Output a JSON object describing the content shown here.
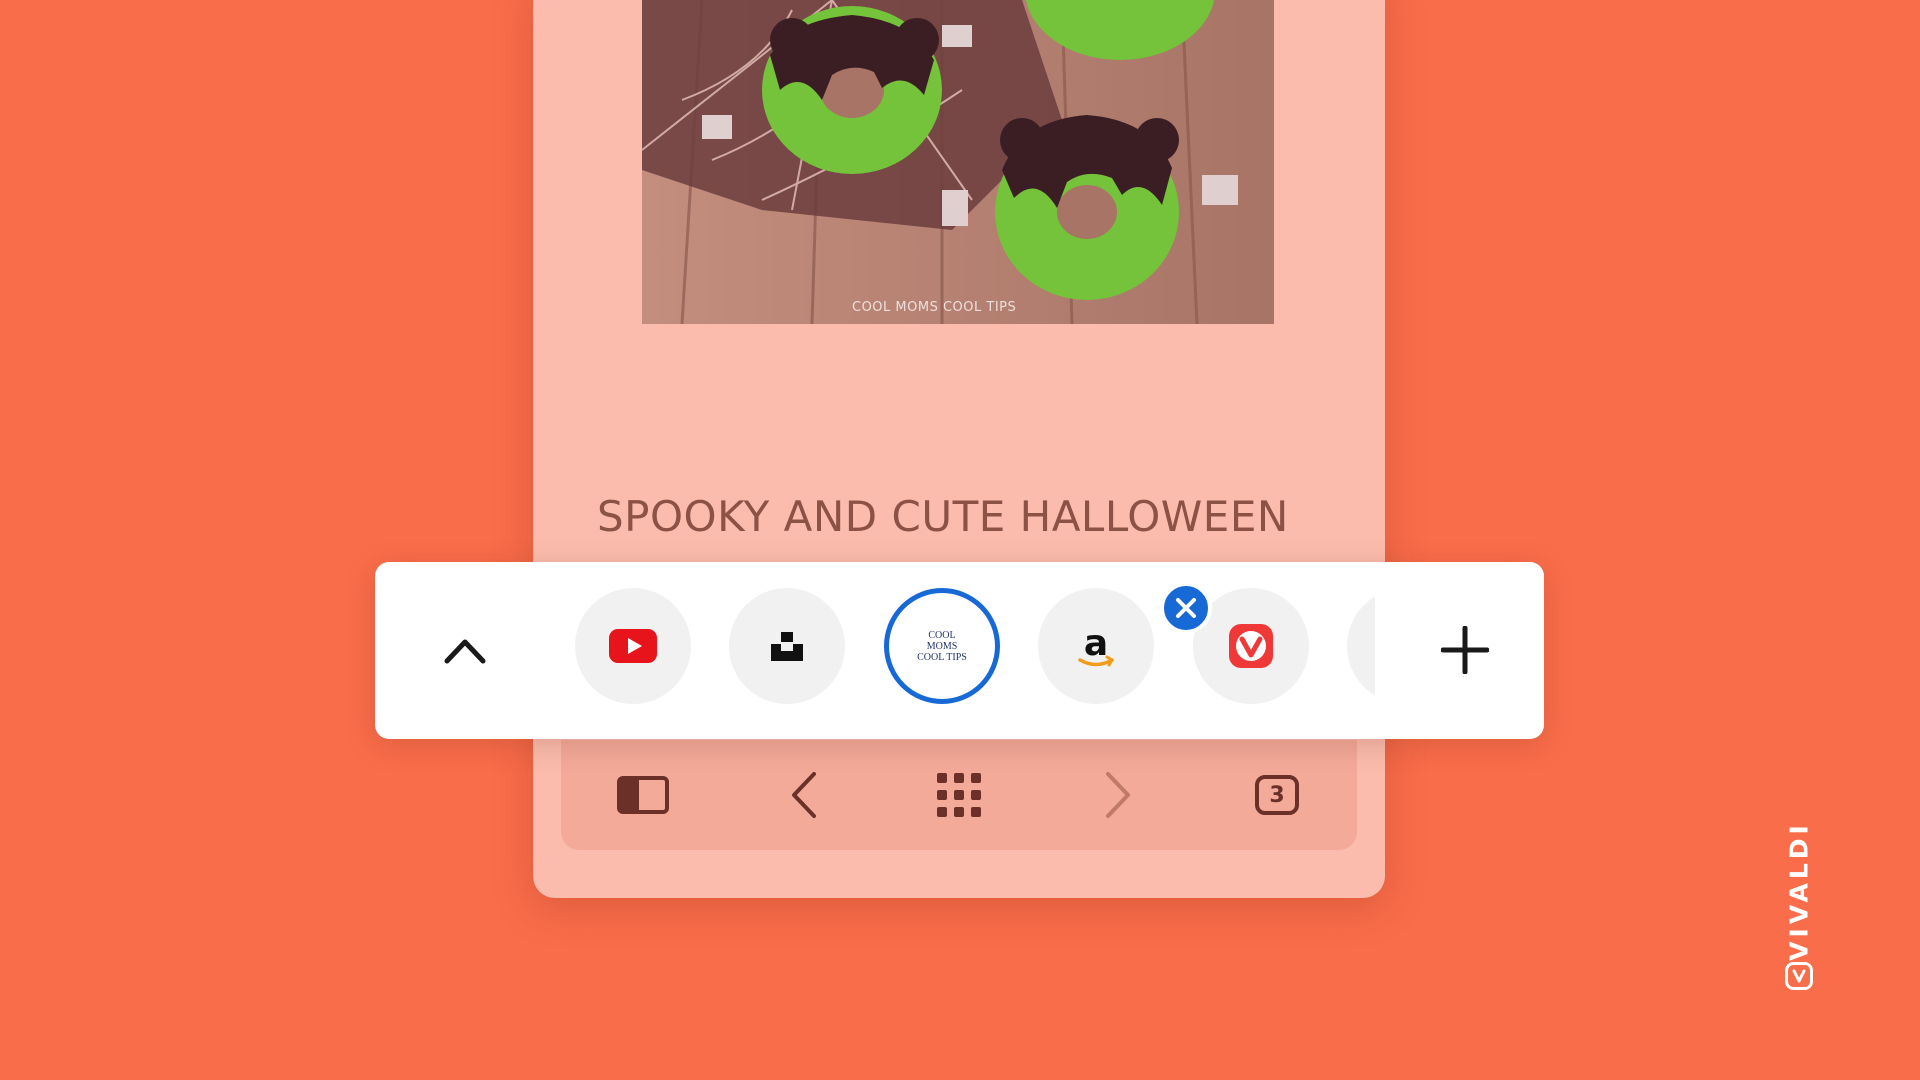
{
  "article": {
    "title": "SPOOKY AND CUTE HALLOWEEN",
    "photo_alt": "green frosted donuts on spider web napkin",
    "photo_watermark": "COOL MOMS COOL TIPS"
  },
  "tab_bar": {
    "collapse_icon": "chevron-up-icon",
    "add_icon": "plus-icon",
    "active_index": 2,
    "tabs": [
      {
        "site": "YouTube",
        "icon": "youtube-icon"
      },
      {
        "site": "Unsplash",
        "icon": "unsplash-icon"
      },
      {
        "site": "Cool Moms Cool Tips",
        "icon": "coolmoms-icon",
        "favicon_text": "COOL MOMS COOL TIPS",
        "active": true
      },
      {
        "site": "Amazon",
        "icon": "amazon-icon",
        "favicon_text": "a"
      },
      {
        "site": "Vivaldi",
        "icon": "vivaldi-icon"
      }
    ],
    "close_icon": "close-icon"
  },
  "toolbar": {
    "buttons": [
      {
        "name": "panel",
        "icon": "panel-toggle-icon"
      },
      {
        "name": "back",
        "icon": "chevron-left-icon"
      },
      {
        "name": "speed-dial",
        "icon": "grid-icon"
      },
      {
        "name": "forward",
        "icon": "chevron-right-icon"
      },
      {
        "name": "tabs",
        "icon": "tab-switcher-icon"
      }
    ],
    "tab_count": "3"
  },
  "brand": {
    "name": "VIVALDI"
  },
  "colors": {
    "background": "#f96d4a",
    "phone": "#fbbcad",
    "active_tab": "#1769d6",
    "toolbar_icons": "#6b3028"
  }
}
